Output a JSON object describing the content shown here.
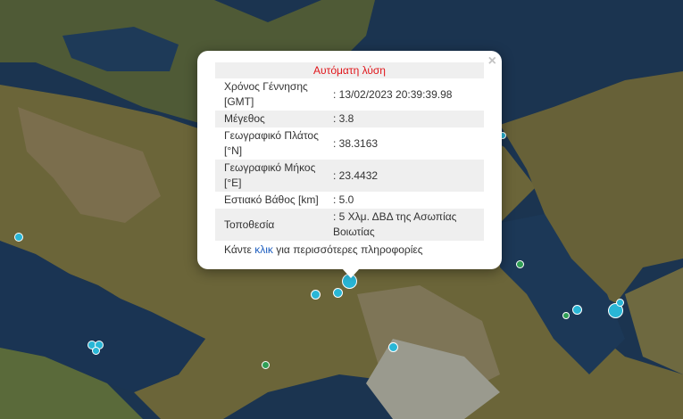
{
  "map": {
    "colors": {
      "sea": "#1b3450",
      "land": "#6b6539",
      "highland": "#7b6e4d",
      "urban": "#9a9a8e",
      "quake_blue": "#29b6d6",
      "quake_green": "#2f9e55"
    },
    "icons": {
      "close": "close-icon"
    }
  },
  "popup": {
    "close": "×",
    "title": "Αυτόματη λύση",
    "rows": [
      {
        "label": "Χρόνος Γέννησης [GMT]",
        "value": ": 13/02/2023 20:39:39.98"
      },
      {
        "label": "Μέγεθος",
        "value": ": 3.8"
      },
      {
        "label": "Γεωγραφικό Πλάτος [°N]",
        "value": ": 38.3163"
      },
      {
        "label": "Γεωγραφικό Μήκος [°E]",
        "value": ": 23.4432"
      },
      {
        "label": "Εστιακό Βάθος [km]",
        "value": ": 5.0"
      },
      {
        "label": "Τοποθεσία",
        "value": ": 5 Χλμ. ΔΒΔ της Ασωπίας Βοιωτίας"
      }
    ],
    "footer_before": "Κάντε",
    "footer_link": "κλικ",
    "footer_after": "για περισσότερες πληροφορίες"
  }
}
